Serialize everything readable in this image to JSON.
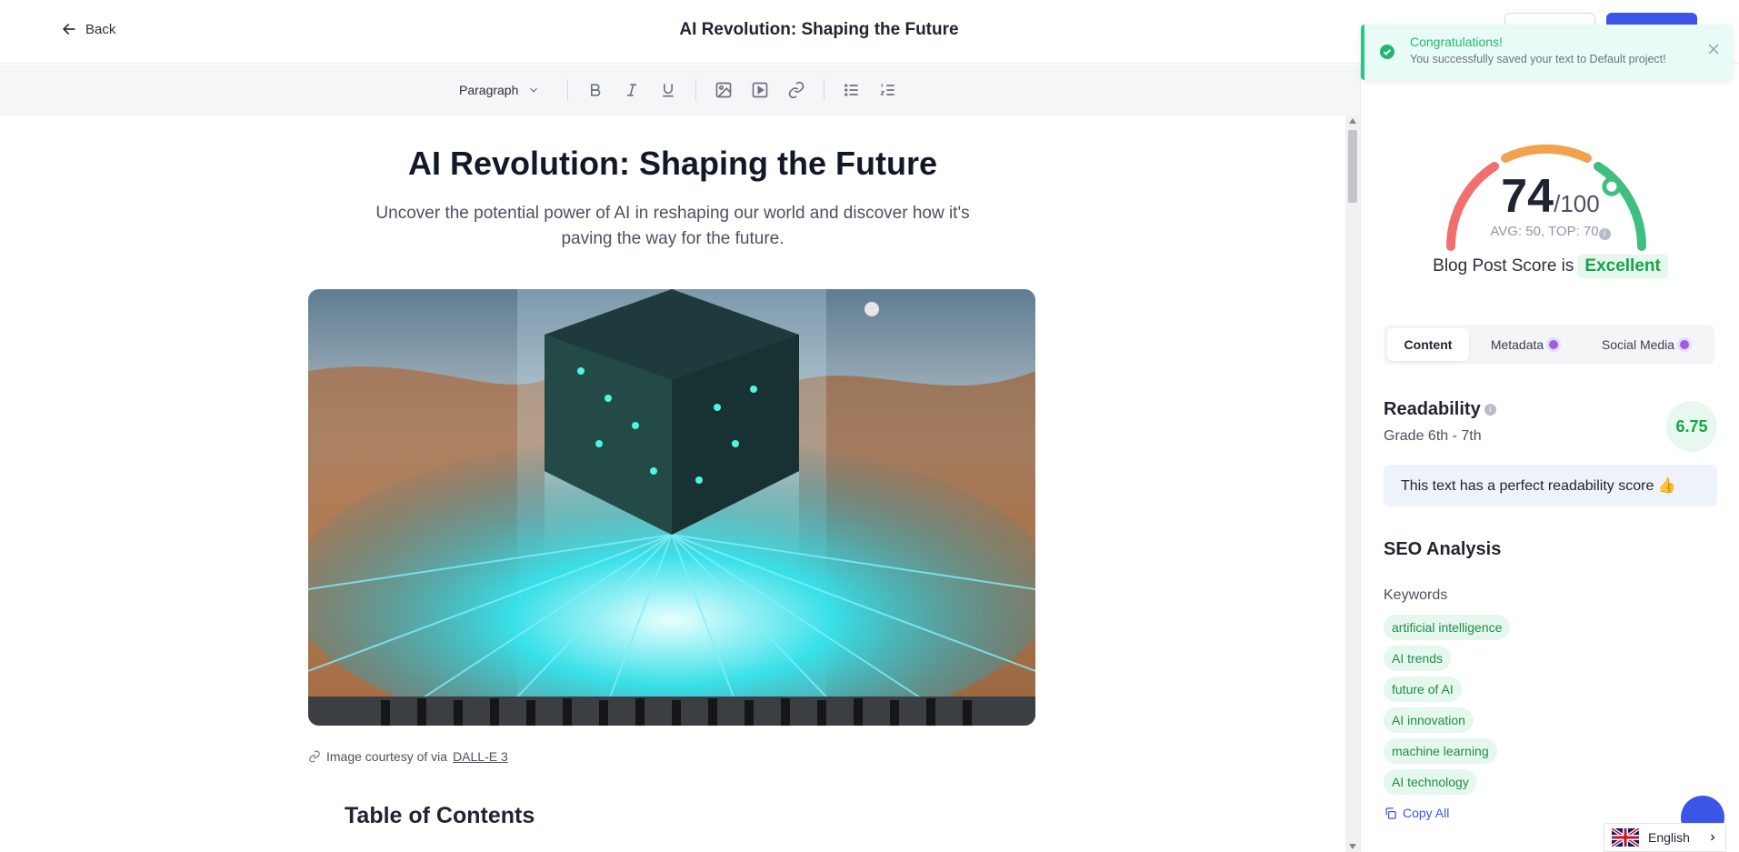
{
  "header": {
    "back_label": "Back",
    "title": "AI Revolution: Shaping the Future"
  },
  "toolbar": {
    "block_type": "Paragraph"
  },
  "editor": {
    "heading": "AI Revolution: Shaping the Future",
    "subtitle": "Uncover the potential power of AI in reshaping our world and discover how it's paving the way for the future.",
    "caption_prefix": "Image courtesy of via",
    "caption_link": "DALL-E 3",
    "toc_heading": "Table of Contents"
  },
  "toast": {
    "title": "Congratulations!",
    "message": "You successfully saved your text to Default project!"
  },
  "score": {
    "value": "74",
    "max": "/100",
    "value_fraction": 0.74,
    "avg_top": "AVG: 50, TOP: 70",
    "label": "Blog Post Score is",
    "rating": "Excellent"
  },
  "tabs": [
    {
      "label": "Content",
      "active": true
    },
    {
      "label": "Metadata",
      "active": false
    },
    {
      "label": "Social Media",
      "active": false
    }
  ],
  "readability": {
    "title": "Readability",
    "grade": "Grade 6th - 7th",
    "score": "6.75",
    "note": "This text has a perfect readability score 👍"
  },
  "seo": {
    "title": "SEO Analysis",
    "keywords_label": "Keywords",
    "keywords": [
      "artificial intelligence",
      "AI trends",
      "future of AI",
      "AI innovation",
      "machine learning",
      "AI technology"
    ],
    "copy_all": "Copy All"
  },
  "language": {
    "selected": "English"
  },
  "colors": {
    "accent": "#3b55e6",
    "success": "#22b573",
    "gauge_red": "#f07070",
    "gauge_orange": "#f2a14f",
    "gauge_green": "#3fbf7f"
  }
}
